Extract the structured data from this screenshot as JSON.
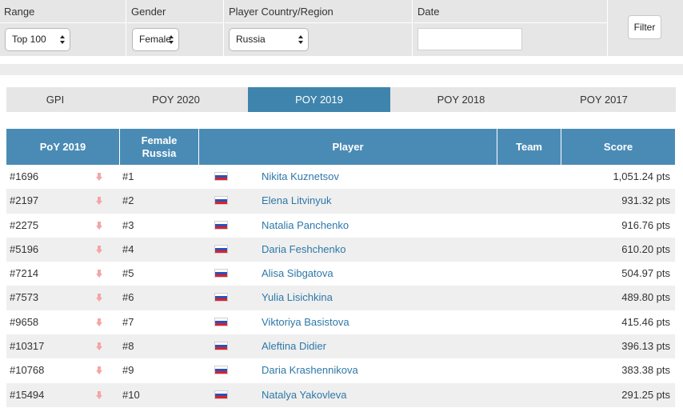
{
  "filters": {
    "range": {
      "label": "Range",
      "value": "Top 100"
    },
    "gender": {
      "label": "Gender",
      "value": "Female"
    },
    "country": {
      "label": "Player Country/Region",
      "value": "Russia"
    },
    "date": {
      "label": "Date",
      "value": ""
    },
    "filter_button": "Filter"
  },
  "tabs": [
    {
      "label": "GPI",
      "active": false
    },
    {
      "label": "POY 2020",
      "active": false
    },
    {
      "label": "POY 2019",
      "active": true
    },
    {
      "label": "POY 2018",
      "active": false
    },
    {
      "label": "POY 2017",
      "active": false
    }
  ],
  "table": {
    "headers": {
      "poy": "PoY 2019",
      "female_line1": "Female",
      "female_line2": "Russia",
      "player": "Player",
      "team": "Team",
      "score": "Score"
    },
    "rows": [
      {
        "rank": "#1696",
        "pos": "#1",
        "name": "Nikita Kuznetsov",
        "score": "1,051.24 pts"
      },
      {
        "rank": "#2197",
        "pos": "#2",
        "name": "Elena Litvinyuk",
        "score": "931.32 pts"
      },
      {
        "rank": "#2275",
        "pos": "#3",
        "name": "Natalia Panchenko",
        "score": "916.76 pts"
      },
      {
        "rank": "#5196",
        "pos": "#4",
        "name": "Daria Feshchenko",
        "score": "610.20 pts"
      },
      {
        "rank": "#7214",
        "pos": "#5",
        "name": "Alisa Sibgatova",
        "score": "504.97 pts"
      },
      {
        "rank": "#7573",
        "pos": "#6",
        "name": "Yulia Lisichkina",
        "score": "489.80 pts"
      },
      {
        "rank": "#9658",
        "pos": "#7",
        "name": "Viktoriya Basistova",
        "score": "415.46 pts"
      },
      {
        "rank": "#10317",
        "pos": "#8",
        "name": "Aleftina Didier",
        "score": "396.13 pts"
      },
      {
        "rank": "#10768",
        "pos": "#9",
        "name": "Daria Krashennikova",
        "score": "383.38 pts"
      },
      {
        "rank": "#15494",
        "pos": "#10",
        "name": "Natalya Yakovleva",
        "score": "291.25 pts"
      }
    ]
  },
  "icons": {
    "trend": "trend-down-icon",
    "flag": "russia-flag-icon"
  },
  "colors": {
    "accent": "#3f84ad",
    "header": "#4a8bb5",
    "link": "#2d78a8",
    "trend_down": "#f3a6a6"
  }
}
